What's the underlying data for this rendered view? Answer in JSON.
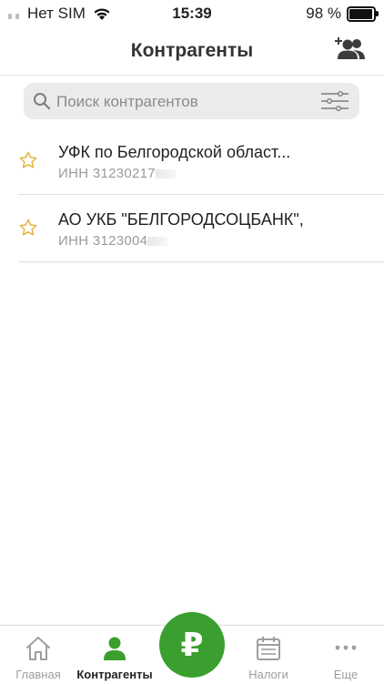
{
  "status_bar": {
    "carrier": "Нет SIM",
    "time": "15:39",
    "battery_text": "98 %",
    "battery_level": 0.98
  },
  "header": {
    "title": "Контрагенты",
    "add_icon": "add-contact-icon"
  },
  "search": {
    "placeholder": "Поиск контрагентов",
    "value": ""
  },
  "contractors": [
    {
      "name": "УФК по Белгородской област...",
      "inn_visible": "ИНН 31230217",
      "favorite": false
    },
    {
      "name": "АО УКБ \"БЕЛГОРОДСОЦБАНК\",",
      "inn_visible": "ИНН 3123004",
      "favorite": false
    }
  ],
  "tabbar": {
    "items": [
      {
        "label": "Главная",
        "icon": "home-icon",
        "active": false
      },
      {
        "label": "Контрагенты",
        "icon": "person-icon",
        "active": true
      },
      {
        "label": "",
        "icon": "ruble-icon",
        "active": false
      },
      {
        "label": "Налоги",
        "icon": "calendar-icon",
        "active": false
      },
      {
        "label": "Еще",
        "icon": "more-icon",
        "active": false
      }
    ],
    "center_button_symbol": "₽"
  },
  "colors": {
    "accent_green": "#3a9f2e",
    "star_gold": "#e3b33d",
    "inactive_gray": "#9e9e9e"
  }
}
